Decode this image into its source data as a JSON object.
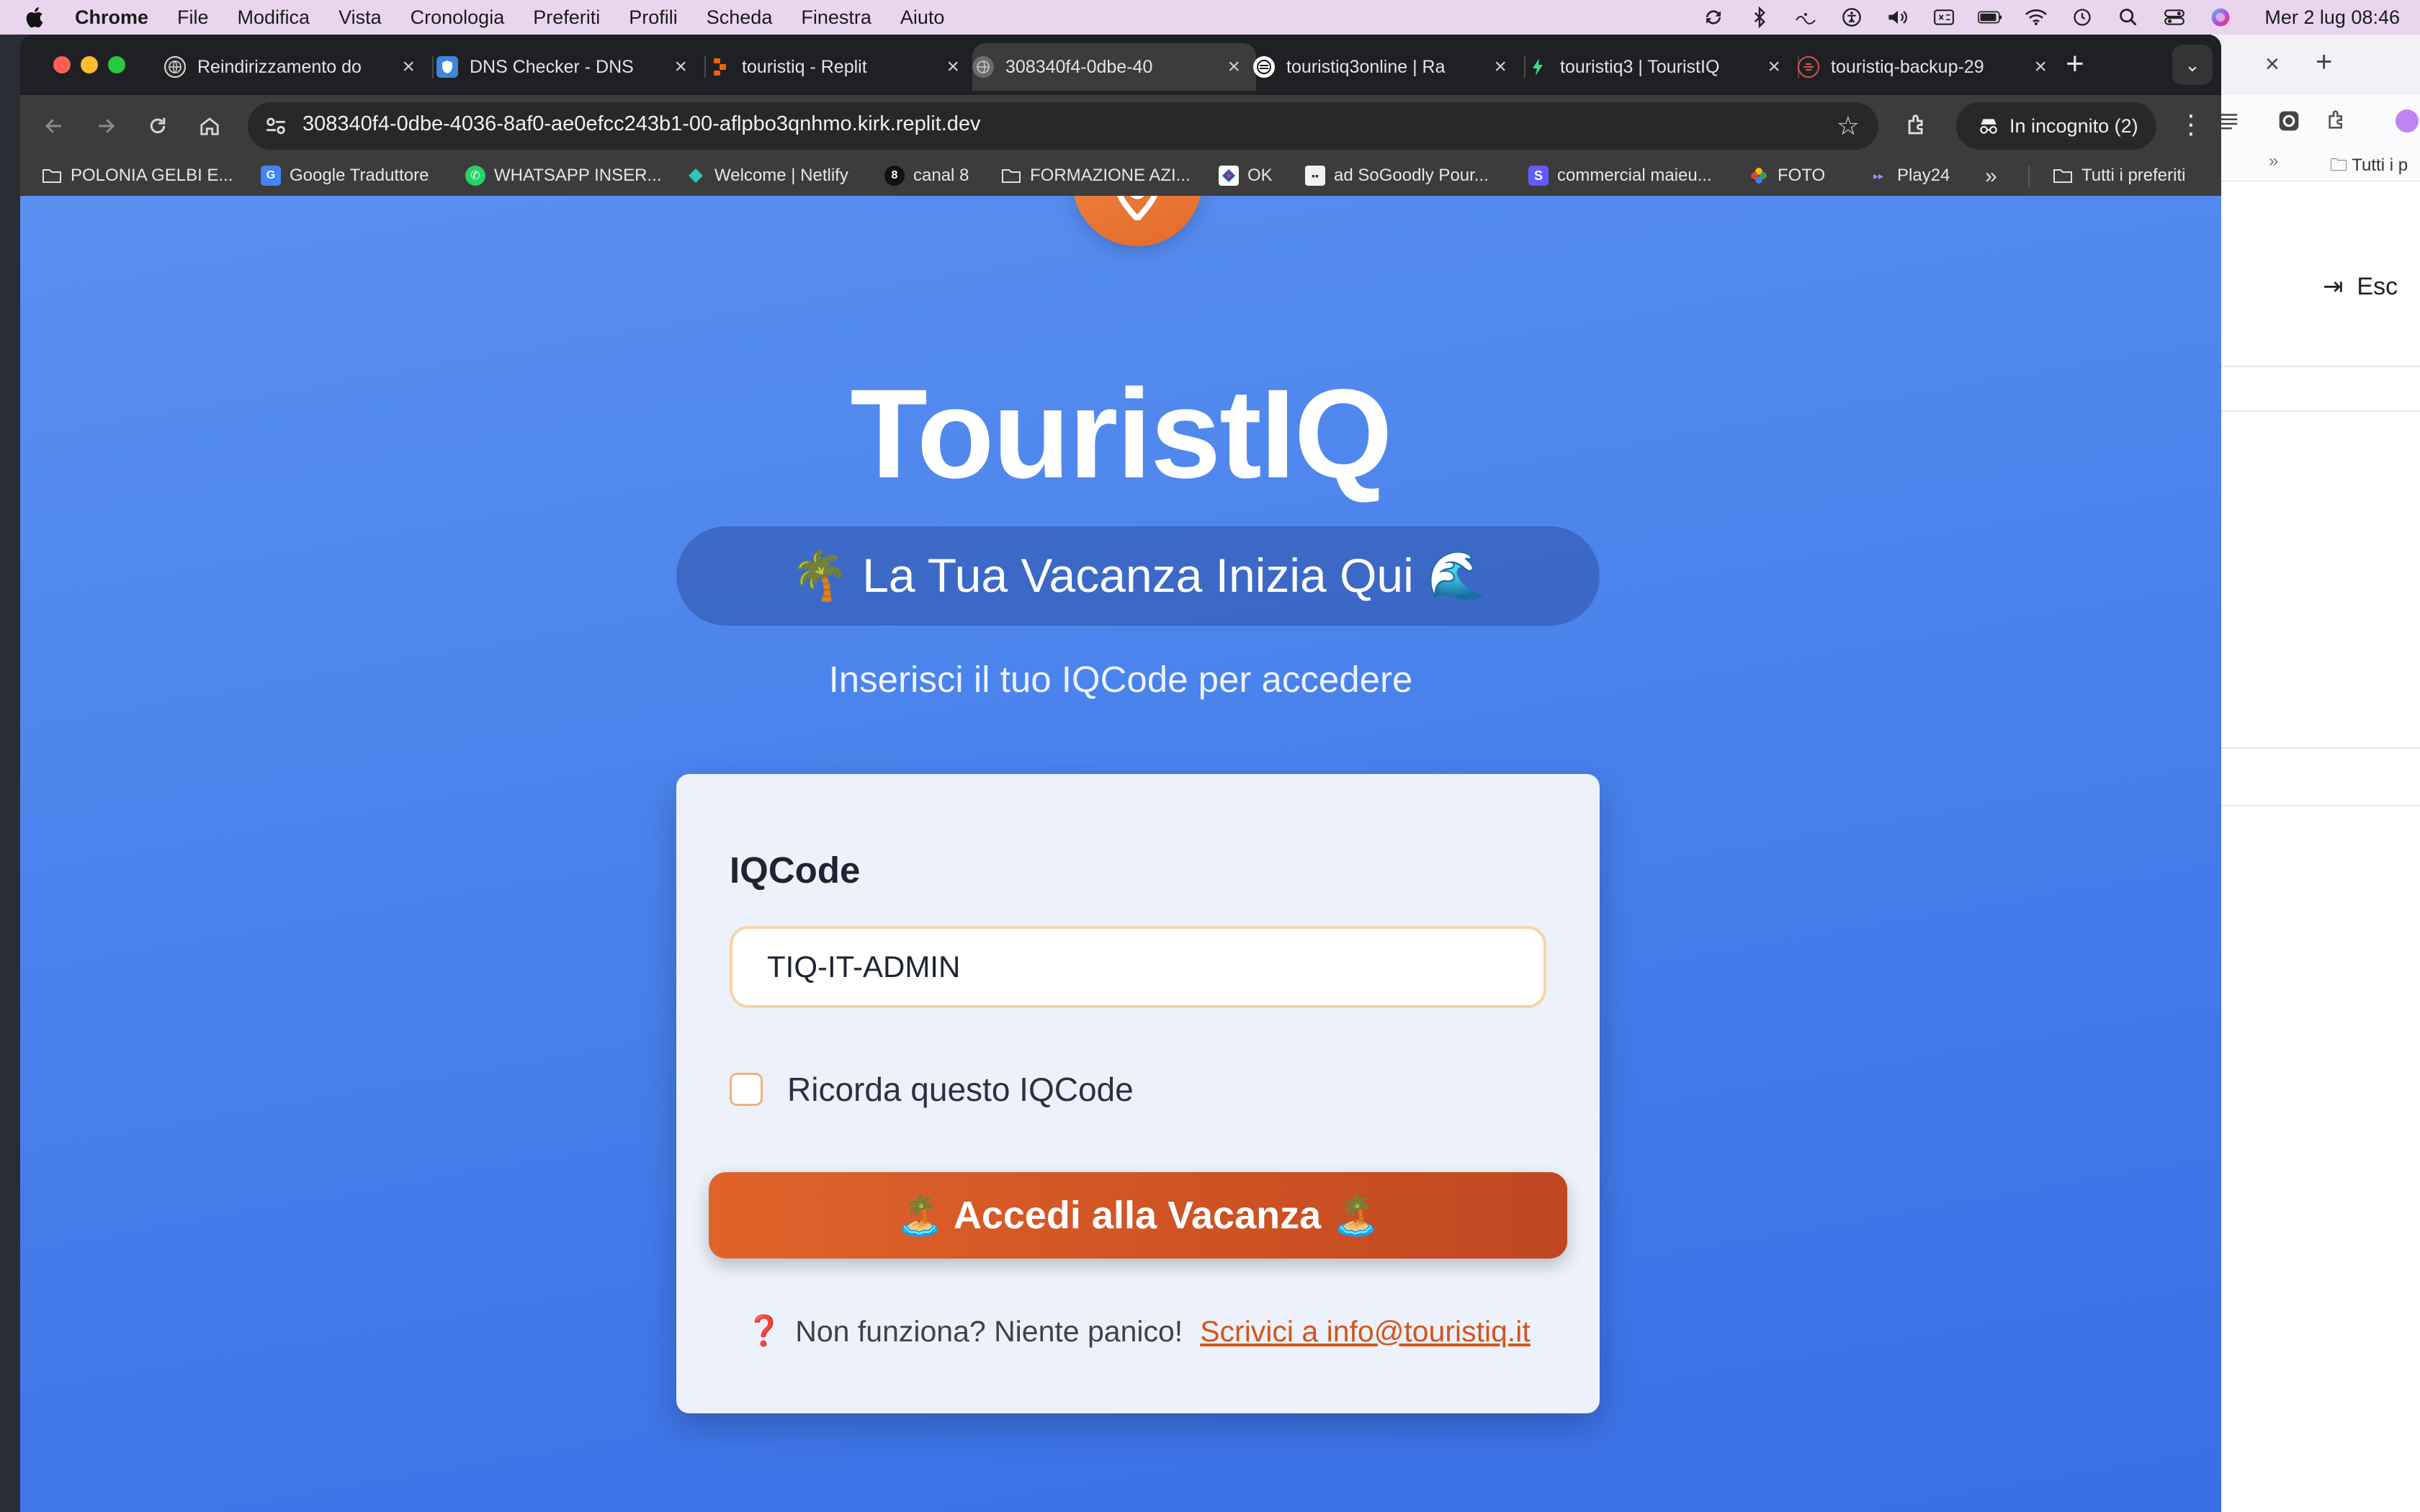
{
  "menubar": {
    "app": "Chrome",
    "items": [
      "File",
      "Modifica",
      "Vista",
      "Cronologia",
      "Preferiti",
      "Profili",
      "Scheda",
      "Finestra",
      "Aiuto"
    ],
    "clock": "Mer 2 lug  08:46"
  },
  "tabs": [
    {
      "title": "Reindirizzamento do",
      "icon": "globe-icon"
    },
    {
      "title": "DNS Checker - DNS",
      "icon": "shield-icon"
    },
    {
      "title": "touristiq - Replit",
      "icon": "replit-icon"
    },
    {
      "title": "308340f4-0dbe-40",
      "icon": "globe-icon"
    },
    {
      "title": "touristiq3online | Ra",
      "icon": "railway-icon"
    },
    {
      "title": "touristiq3 | TouristIQ",
      "icon": "bolt-icon"
    },
    {
      "title": "touristiq-backup-29",
      "icon": "backup-icon"
    }
  ],
  "address_bar": {
    "url": "308340f4-0dbe-4036-8af0-ae0efcc243b1-00-aflpbo3qnhmo.kirk.replit.dev"
  },
  "incognito_label": "In incognito (2)",
  "bookmarks": [
    {
      "label": "POLONIA GELBI E...",
      "icon": "folder-icon"
    },
    {
      "label": "Google Traduttore",
      "icon": "translate-icon"
    },
    {
      "label": "WHATSAPP INSER...",
      "icon": "whatsapp-icon"
    },
    {
      "label": "Welcome | Netlify",
      "icon": "netlify-icon"
    },
    {
      "label": "canal 8",
      "icon": "number-icon"
    },
    {
      "label": "FORMAZIONE AZI...",
      "icon": "folder-icon"
    },
    {
      "label": "OK",
      "icon": "diamond-icon"
    },
    {
      "label": "ad SoGoodly Pour...",
      "icon": "image-icon"
    },
    {
      "label": "commercial maieu...",
      "icon": "s-icon"
    },
    {
      "label": "FOTO",
      "icon": "pinwheel-icon"
    },
    {
      "label": "Play24",
      "icon": "play-icon"
    }
  ],
  "bookmarks_all": "Tutti i preferiti",
  "bg_window": {
    "bookmarks_all": "Tutti i p",
    "logout": "Esc"
  },
  "page": {
    "brand": "TouristIQ",
    "tagline": "🌴 La Tua Vacanza Inizia Qui 🌊",
    "subtitle": "Inserisci il tuo IQCode per accedere",
    "form": {
      "label": "IQCode",
      "value": "TIQ-IT-ADMIN",
      "remember_label": "Ricorda questo IQCode",
      "remember_checked": false,
      "submit_label": "🏝️ Accedi alla Vacanza 🏝️",
      "help_icon": "❓",
      "help_text": "Non funziona? Niente panico!",
      "help_link": "Scrivici a info@touristiq.it"
    }
  },
  "colors": {
    "page_bg": "#4f87ee",
    "accent": "#d9592a",
    "card_bg": "#edf1fb"
  }
}
